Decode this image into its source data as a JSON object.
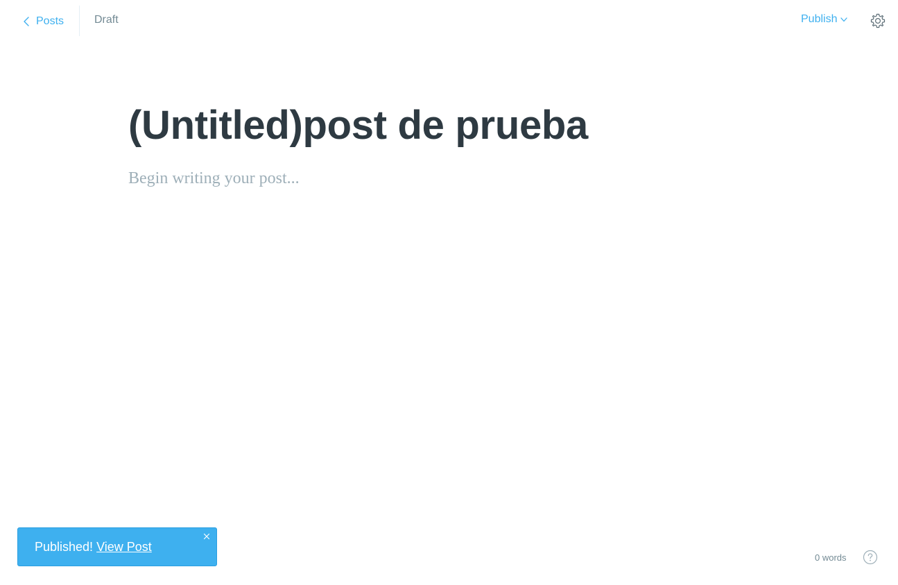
{
  "nav": {
    "back_label": "Posts",
    "status": "Draft",
    "publish_label": "Publish"
  },
  "editor": {
    "title": "(Untitled)post de prueba",
    "body_placeholder": "Begin writing your post..."
  },
  "notification": {
    "message": "Published!",
    "link_label": "View Post"
  },
  "footer": {
    "word_count": "0 words"
  },
  "icons": {
    "back": "chevron-left-icon",
    "publish_caret": "chevron-down-icon",
    "settings": "gear-icon",
    "close": "close-icon",
    "help": "question-circle-icon"
  },
  "colors": {
    "accent": "#3eb0ef",
    "title_text": "#2e3a42",
    "muted_text": "#738a94",
    "placeholder_text": "#9eafb8"
  }
}
